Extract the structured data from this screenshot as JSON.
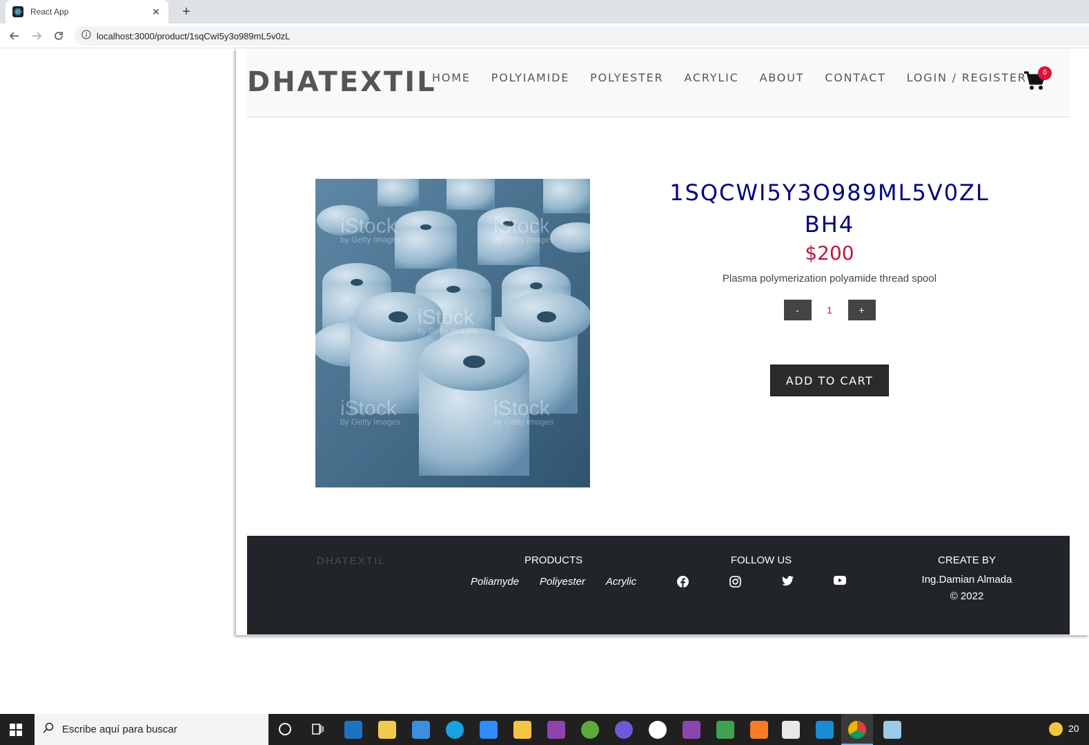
{
  "browser": {
    "tab_title": "React App",
    "tab_close": "✕",
    "new_tab": "+",
    "url": "localhost:3000/product/1sqCwI5y3o989mL5v0zL"
  },
  "header": {
    "brand": "DHATEXTIL",
    "nav": [
      "HOME",
      "POLYIAMIDE",
      "POLYESTER",
      "ACRYLIC",
      "ABOUT",
      "CONTACT",
      "LOGIN / REGISTER"
    ],
    "cart_count": "0"
  },
  "product": {
    "title_line1": "1SQCWI5Y3O989ML5V0ZL",
    "title_line2": "BH4",
    "price": "$200",
    "description": "Plasma polymerization polyamide thread spool",
    "qty_minus": "-",
    "qty_value": "1",
    "qty_plus": "+",
    "add_to_cart": "ADD TO CART",
    "image_watermark": "iStock",
    "image_watermark_sub": "by Getty Images"
  },
  "footer": {
    "brand": "DHATEXTIL",
    "products_heading": "PRODUCTS",
    "products": [
      "Poliamyde",
      "Poliyester",
      "Acrylic"
    ],
    "follow_heading": "FOLLOW US",
    "social": [
      "facebook-icon",
      "instagram-icon",
      "twitter-icon",
      "youtube-icon"
    ],
    "create_heading": "CREATE BY",
    "author": "Ing.Damian Almada",
    "copyright": "© 2022"
  },
  "taskbar": {
    "search_placeholder": "Escribe aquí para buscar",
    "tray_text": "20"
  },
  "colors": {
    "title": "#000080",
    "price": "#c0163c",
    "footer_bg": "#212529",
    "badge": "#dc143c"
  }
}
